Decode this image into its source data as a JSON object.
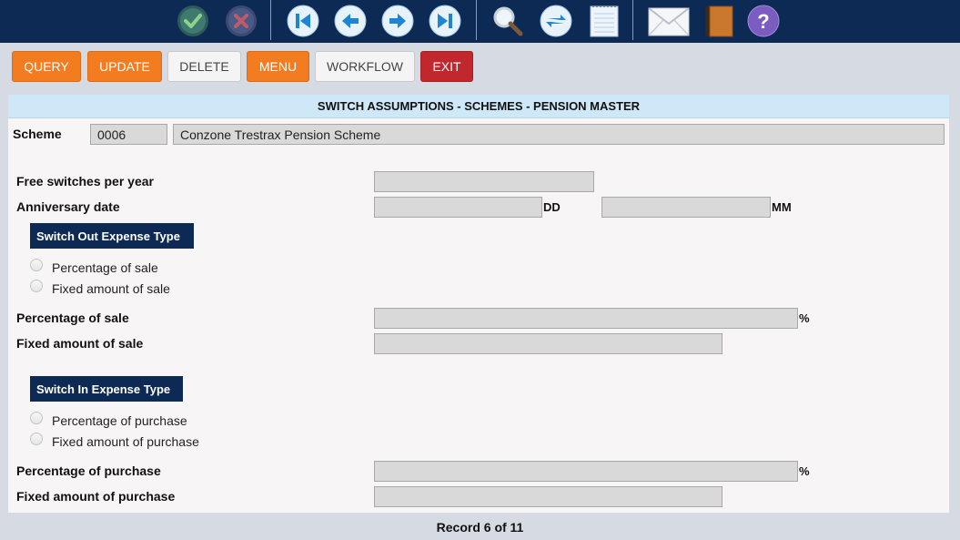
{
  "toolbar": {
    "icons": [
      "confirm-icon",
      "cancel-icon",
      "first-record-icon",
      "previous-record-icon",
      "next-record-icon",
      "last-record-icon",
      "search-icon",
      "refresh-icon",
      "notepad-icon",
      "mail-icon",
      "book-icon",
      "help-icon"
    ],
    "help_glyph": "?"
  },
  "actions": {
    "query": "QUERY",
    "update": "UPDATE",
    "delete": "DELETE",
    "menu": "MENU",
    "workflow": "WORKFLOW",
    "exit": "EXIT"
  },
  "colors": {
    "navy": "#0d2a55",
    "orange": "#f47c20",
    "red": "#c0282e",
    "header_blue": "#cfe8f7"
  },
  "page_title": "SWITCH ASSUMPTIONS - SCHEMES - PENSION MASTER",
  "scheme": {
    "label": "Scheme",
    "code": "0006",
    "name": "Conzone Trestrax Pension Scheme"
  },
  "form": {
    "free_switches_label": "Free switches per year",
    "free_switches_value": "",
    "anniversary_label": "Anniversary date",
    "anniversary_dd": "",
    "dd_unit": "DD",
    "anniversary_mm": "",
    "mm_unit": "MM"
  },
  "switch_out": {
    "heading": "Switch Out Expense Type",
    "options": [
      "Percentage of sale",
      "Fixed amount of sale"
    ],
    "percentage_label": "Percentage of sale",
    "percentage_value": "",
    "fixed_label": "Fixed amount of sale",
    "fixed_value": ""
  },
  "switch_in": {
    "heading": "Switch In Expense Type",
    "options": [
      "Percentage of purchase",
      "Fixed amount of purchase"
    ],
    "percentage_label": "Percentage of purchase",
    "percentage_value": "",
    "fixed_label": "Fixed amount of purchase",
    "fixed_value": ""
  },
  "percent_unit": "%",
  "record_status": "Record 6 of 11"
}
